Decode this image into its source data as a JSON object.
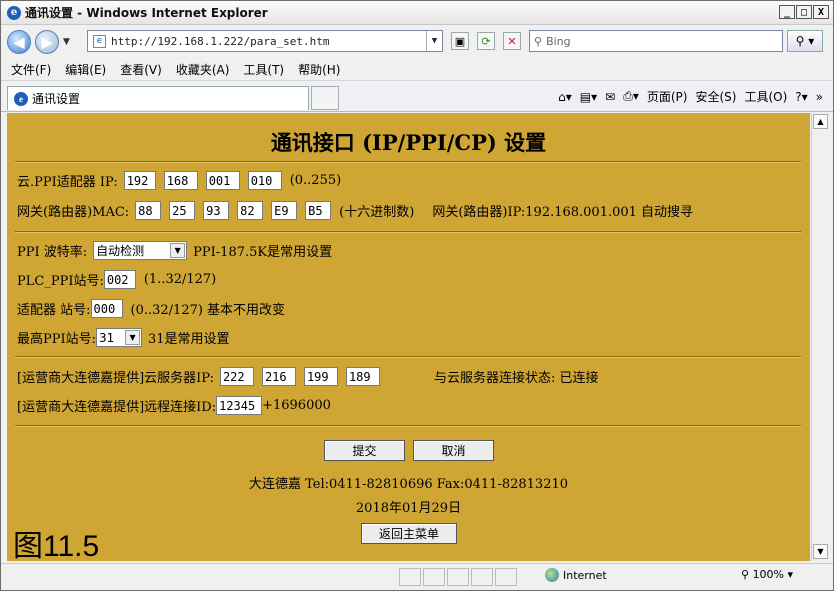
{
  "window": {
    "title": "通讯设置 - Windows Internet Explorer",
    "min": "_",
    "max": "□",
    "close": "X"
  },
  "address": {
    "url": "http://192.168.1.222/para_set.htm",
    "search_placeholder": "Bing"
  },
  "menu": [
    "文件(F)",
    "编辑(E)",
    "查看(V)",
    "收藏夹(A)",
    "工具(T)",
    "帮助(H)"
  ],
  "tab": {
    "label": "通讯设置"
  },
  "commands": {
    "page": "页面(P)",
    "safety": "安全(S)",
    "tools": "工具(O)"
  },
  "page": {
    "heading": "通讯接口 (IP/PPI/CP) 设置",
    "ip_label": "云.PPI适配器 IP:",
    "ip": [
      "192",
      "168",
      "001",
      "010"
    ],
    "ip_range": "(0..255)",
    "mac_label": "网关(路由器)MAC:",
    "mac": [
      "88",
      "25",
      "93",
      "82",
      "E9",
      "B5"
    ],
    "mac_hint": "(十六进制数)",
    "gateway_info": "网关(路由器)IP:192.168.001.001 自动搜寻",
    "baud_label": "PPI 波特率:",
    "baud_value": "自动检测",
    "baud_hint": "PPI-187.5K是常用设置",
    "plc_label": "PLC_PPI站号:",
    "plc_value": "002",
    "plc_hint": "(1..32/127)",
    "adapter_label": "适配器 站号:",
    "adapter_value": "000",
    "adapter_hint": "(0..32/127) 基本不用改变",
    "max_label": "最高PPI站号:",
    "max_value": "31",
    "max_hint": "31是常用设置",
    "cloud_label": "[运营商大连德嘉提供]云服务器IP:",
    "cloud_ip": [
      "222",
      "216",
      "199",
      "189"
    ],
    "cloud_status": "与云服务器连接状态: 已连接",
    "remote_label": "[运营商大连德嘉提供]远程连接ID:",
    "remote_value": "12345",
    "remote_suffix": "+1696000",
    "submit": "提交",
    "cancel": "取消",
    "contact": "大连德嘉 Tel:0411-82810696   Fax:0411-82813210",
    "date": "2018年01月29日",
    "back": "返回主菜单",
    "figure": "图11.5"
  },
  "status": {
    "zone": "Internet",
    "zoom": "100%"
  }
}
